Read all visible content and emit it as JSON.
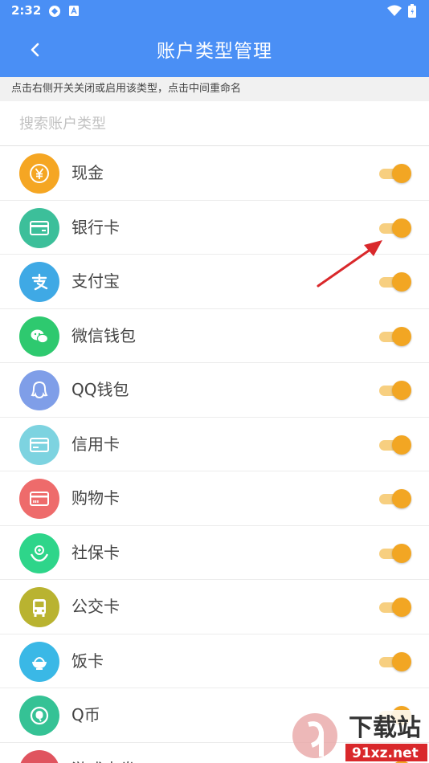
{
  "status_bar": {
    "time": "2:32"
  },
  "header": {
    "title": "账户类型管理"
  },
  "hint": "点击右侧开关关闭或启用该类型，点击中间重命名",
  "search": {
    "placeholder": "搜索账户类型",
    "value": ""
  },
  "accounts": [
    {
      "label": "现金",
      "icon": "yen-coin-icon",
      "color": "#f5a623",
      "enabled": true
    },
    {
      "label": "银行卡",
      "icon": "bank-card-icon",
      "color": "#3cbf9a",
      "enabled": true
    },
    {
      "label": "支付宝",
      "icon": "alipay-icon",
      "color": "#3fa9e5",
      "enabled": true
    },
    {
      "label": "微信钱包",
      "icon": "wechat-icon",
      "color": "#2ec96f",
      "enabled": true
    },
    {
      "label": "QQ钱包",
      "icon": "qq-penguin-icon",
      "color": "#7f9ee8",
      "enabled": true
    },
    {
      "label": "信用卡",
      "icon": "credit-card-icon",
      "color": "#7dd3e0",
      "enabled": true
    },
    {
      "label": "购物卡",
      "icon": "shopping-card-icon",
      "color": "#ee6b6b",
      "enabled": true
    },
    {
      "label": "社保卡",
      "icon": "social-security-icon",
      "color": "#2ed58a",
      "enabled": true
    },
    {
      "label": "公交卡",
      "icon": "bus-icon",
      "color": "#b9b330",
      "enabled": true
    },
    {
      "label": "饭卡",
      "icon": "rice-bowl-icon",
      "color": "#3ab8e6",
      "enabled": true
    },
    {
      "label": "Q币",
      "icon": "q-coin-icon",
      "color": "#35c295",
      "enabled": true
    },
    {
      "label": "游戏点券",
      "icon": "game-icon",
      "color": "#e0545f",
      "enabled": true
    }
  ],
  "colors": {
    "header": "#4a8ff5",
    "toggle_on": "#f2a623",
    "arrow": "#d9282b"
  },
  "watermark": {
    "brand": "下载站",
    "domain": "91xz.net"
  }
}
